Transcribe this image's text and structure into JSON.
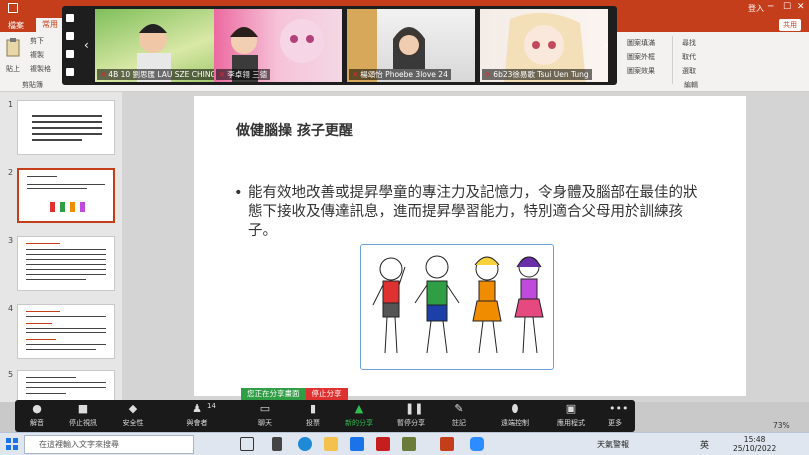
{
  "titlebar": {
    "login": "登入",
    "share": "共用"
  },
  "tabs": [
    {
      "label": "檔案"
    },
    {
      "label": "常用"
    }
  ],
  "ribbon": {
    "paste": "貼上",
    "cut": "剪下",
    "copy": "複製",
    "format": "複製格",
    "clipboard": "剪貼簿",
    "arrange_shape": "圖案填滿",
    "arrange_outline": "圖案外框",
    "arrange_effect": "圖案效果",
    "find": "尋找",
    "replace": "取代",
    "select": "選取",
    "edit_group": "編輯"
  },
  "participants": [
    {
      "name": "4B 10 劉思匯 LAU SZE CHING",
      "muted": true
    },
    {
      "name": "李卓翎 三德",
      "muted": true
    },
    {
      "name": "楊頌怡 Phoebe 3love 24",
      "muted": true
    },
    {
      "name": "6b23徐易歌 Tsui Uen Tung",
      "muted": true
    }
  ],
  "slides": [
    {
      "num": "1"
    },
    {
      "num": "2"
    },
    {
      "num": "3"
    },
    {
      "num": "4"
    },
    {
      "num": "5"
    }
  ],
  "slide": {
    "title": "做健腦操 孩子更醒",
    "body": "能有效地改善或提昇學童的專注力及記憶力，令身體及腦部在最佳的狀態下接收及傳達訊息，進而提昇學習能力，特別適合父母用於訓練孩子。",
    "bullet": "•"
  },
  "sharebar": {
    "sharing": "您正在分享畫面",
    "stop": "停止分享"
  },
  "zoom_toolbar": [
    {
      "label": "解音",
      "icon": "mic-icon"
    },
    {
      "label": "停止視訊",
      "icon": "video-icon"
    },
    {
      "label": "安全性",
      "icon": "shield-icon"
    },
    {
      "label": "與會者",
      "icon": "participants-icon",
      "count": "14"
    },
    {
      "label": "聊天",
      "icon": "chat-icon"
    },
    {
      "label": "投票",
      "icon": "poll-icon"
    },
    {
      "label": "新的分享",
      "icon": "share-icon"
    },
    {
      "label": "暫停分享",
      "icon": "pause-icon"
    },
    {
      "label": "註記",
      "icon": "annotate-icon"
    },
    {
      "label": "遠端控制",
      "icon": "remote-icon"
    },
    {
      "label": "應用程式",
      "icon": "apps-icon"
    },
    {
      "label": "更多",
      "icon": "more-icon"
    }
  ],
  "zoom": {
    "value": "73%"
  },
  "taskbar": {
    "search_placeholder": "在這裡輸入文字來搜尋",
    "weather": "天氣警報",
    "lang": "英",
    "time": "15:48",
    "date": "25/10/2022"
  },
  "colors": {
    "accent": "#c43e1c",
    "share_green": "#2f9e44",
    "stop_red": "#e03131"
  }
}
